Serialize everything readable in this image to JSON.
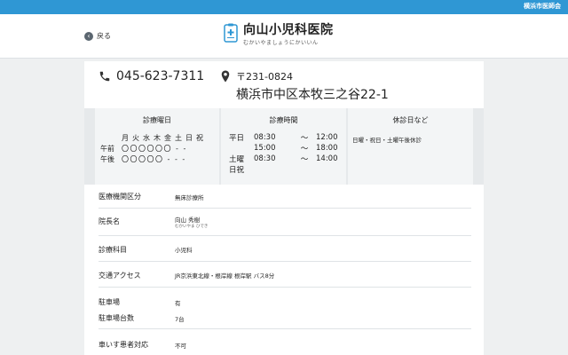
{
  "topbar": {
    "association": "横浜市医師会"
  },
  "header": {
    "back_label": "戻る",
    "clinic_name": "向山小児科医院",
    "clinic_kana": "むかいやましょうにかいいん"
  },
  "contact": {
    "phone": "045-623-7311",
    "postal": "〒231-0824",
    "address": "横浜市中区本牧三之谷22-1"
  },
  "schedule": {
    "days_header": "診療曜日",
    "days": "月火水木金土日祝",
    "am_label": "午前",
    "am_marks": "〇〇〇〇〇〇 - -",
    "pm_label": "午後",
    "pm_marks": "〇〇〇〇〇 - - -",
    "hours_header": "診療時間",
    "weekday_label": "平日",
    "wd_am_start": "08:30",
    "wd_am_tilde": "～",
    "wd_am_end": "12:00",
    "wd_pm_start": "15:00",
    "wd_pm_tilde": "～",
    "wd_pm_end": "18:00",
    "sat_label": "土曜",
    "sat_start": "08:30",
    "sat_tilde": "～",
    "sat_end": "14:00",
    "sun_label": "日祝",
    "holiday_header": "休診日など",
    "holiday_text": "日曜・祝日・土曜午後休診"
  },
  "details": {
    "type_label": "医療機関区分",
    "type_value": "無床診療所",
    "director_label": "院長名",
    "director_value": "向山 秀樹",
    "director_kana": "むかいやま ひでき",
    "dept_label": "診療科目",
    "dept_value": "小児科",
    "access_label": "交通アクセス",
    "access_value": "JR京浜東北線・根岸線 根岸駅 バス8分",
    "parking_label": "駐車場",
    "parking_value": "有",
    "parking_count_label": "駐車場台数",
    "parking_count_value": "7台",
    "wheelchair_label": "車いす患者対応",
    "wheelchair_value": "不可"
  }
}
